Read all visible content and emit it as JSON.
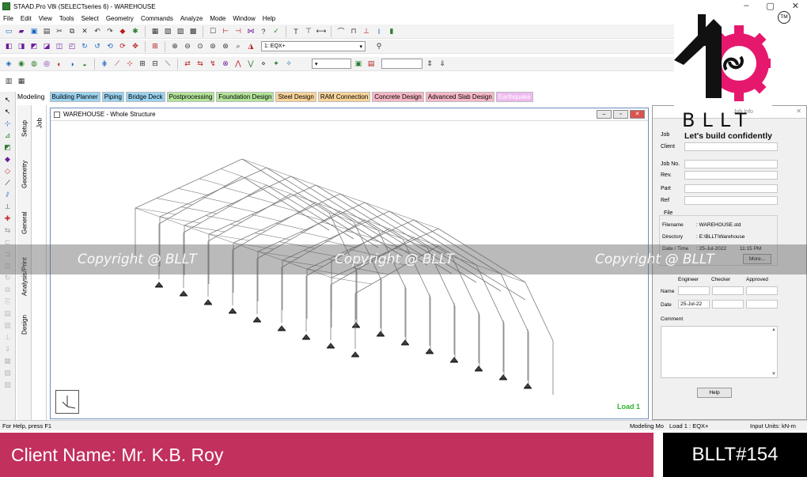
{
  "window": {
    "title": "STAAD.Pro V8i (SELECTseries 6) - WAREHOUSE",
    "controls": [
      "–",
      "▢",
      "✕"
    ]
  },
  "menu": [
    "File",
    "Edit",
    "View",
    "Tools",
    "Select",
    "Geometry",
    "Commands",
    "Analyze",
    "Mode",
    "Window",
    "Help"
  ],
  "toolbar": {
    "load_case": "1: EQX+"
  },
  "modes": {
    "label": "Modeling",
    "tabs": [
      {
        "label": "Building Planner",
        "color": "#9bd3f0"
      },
      {
        "label": "Piping",
        "color": "#9bd3f0"
      },
      {
        "label": "Bridge Deck",
        "color": "#9bd3f0"
      },
      {
        "label": "Postprocessing",
        "color": "#b3e49a"
      },
      {
        "label": "Foundation Design",
        "color": "#b3e49a"
      },
      {
        "label": "Steel Design",
        "color": "#f8d49a"
      },
      {
        "label": "RAM Connection",
        "color": "#f8d49a"
      },
      {
        "label": "Concrete Design",
        "color": "#f6b7c6"
      },
      {
        "label": "Advanced Slab Design",
        "color": "#f6b7c6"
      },
      {
        "label": "Earthquake",
        "color": "#f0b8f0"
      }
    ]
  },
  "side_tabs": {
    "outer": [
      "Setup",
      "Geometry",
      "General",
      "Analysis/Print",
      "Design"
    ],
    "inner": "Job"
  },
  "view_window": {
    "title": "WAREHOUSE - Whole Structure",
    "load_label": "Load 1"
  },
  "job_info": {
    "title": "Job Info",
    "fields": [
      "Job",
      "Client",
      "Job No.",
      "Rev.",
      "Part",
      "Ref"
    ],
    "file_section": "File",
    "filename_label": "Filename",
    "filename": ": WAREHOUSE.std",
    "directory_label": "Directory",
    "directory": ": E:\\BLLT\\Warehouse",
    "datetime_label": "Date / Time",
    "date": ": 25-Jul-2022",
    "time": "11:15 PM",
    "more_button": "More...",
    "columns": [
      "Engineer",
      "Checker",
      "Approved"
    ],
    "name_label": "Name",
    "date_label": "Date",
    "engineer_date": "25-Jul-22",
    "comment_label": "Comment",
    "help_button": "Help"
  },
  "status": {
    "help": "For Help, press F1",
    "mode": "Modeling Mo",
    "load": "Load 1 : EQX+",
    "units": "Input Units:  kN-m"
  },
  "watermark": "Copyright @ BLLT",
  "brand": {
    "name": "BLLT",
    "tagline": "Let's build confidently",
    "tm": "TM",
    "accent": "#e6186e"
  },
  "footer": {
    "client": "Client Name: Mr. K.B. Roy",
    "code": "BLLT#154",
    "left_color": "#c2305d"
  }
}
